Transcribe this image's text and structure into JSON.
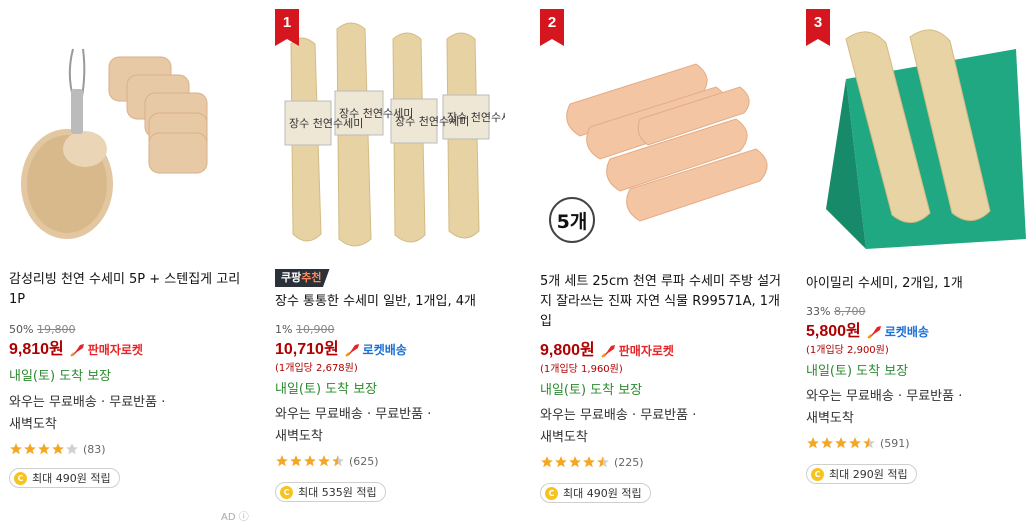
{
  "products": [
    {
      "rank": "",
      "badge": "",
      "name": "감성리빙 천연 수세미 5P + 스텐집게 고리 1P",
      "discount": "50%",
      "original_price": "19,800",
      "price": "9,810원",
      "delivery_badge": "판매자로켓",
      "delivery_badge_color": "#e52528",
      "unit_price": "",
      "arrival": "내일(토) 도착 보장",
      "wow_line1": "와우는 무료배송 · 무료반품 ·",
      "wow_line2": "새벽도착",
      "rating": 4,
      "reviews": "(83)",
      "reward": "최대 490원 적립",
      "ad_label": "AD"
    },
    {
      "rank": "1",
      "badge_part1": "쿠팡",
      "badge_part2": "추천",
      "name": "장수 통통한 수세미 일반, 1개입, 4개",
      "discount": "1%",
      "original_price": "10,900",
      "price": "10,710원",
      "delivery_badge": "로켓배송",
      "delivery_badge_color": "#1b6fd6",
      "unit_price": "(1개입당 2,678원)",
      "arrival": "내일(토) 도착 보장",
      "wow_line1": "와우는 무료배송 · 무료반품 ·",
      "wow_line2": "새벽도착",
      "rating": 4.5,
      "reviews": "(625)",
      "reward": "최대 535원 적립",
      "image_labels": [
        "장수 천연수세미",
        "장수 천연수세미",
        "장수 천연수세미",
        "장수 천연수세미"
      ]
    },
    {
      "rank": "2",
      "name": "5개 세트 25cm 천연 루파 수세미 주방 설거지 잘라쓰는 진짜 자연 식물 R99571A, 1개입",
      "discount": "",
      "original_price": "",
      "price": "9,800원",
      "delivery_badge": "판매자로켓",
      "delivery_badge_color": "#e52528",
      "unit_price": "(1개입당 1,960원)",
      "arrival": "내일(토) 도착 보장",
      "wow_line1": "와우는 무료배송 · 무료반품 ·",
      "wow_line2": "새벽도착",
      "rating": 4.5,
      "reviews": "(225)",
      "reward": "최대 490원 적립",
      "image_count_label": "5개"
    },
    {
      "rank": "3",
      "name": "아이밀리 수세미, 2개입, 1개",
      "discount": "33%",
      "original_price": "8,700",
      "price": "5,800원",
      "delivery_badge": "로켓배송",
      "delivery_badge_color": "#1b6fd6",
      "unit_price": "(1개입당 2,900원)",
      "arrival": "내일(토) 도착 보장",
      "wow_line1": "와우는 무료배송 · 무료반품 ·",
      "wow_line2": "새벽도착",
      "rating": 4.5,
      "reviews": "(591)",
      "reward": "최대 290원 적립"
    }
  ],
  "colors": {
    "price": "#ae0000",
    "arrival": "#2e8b31",
    "rank_badge": "#d6161e",
    "star": "#f5a623"
  }
}
